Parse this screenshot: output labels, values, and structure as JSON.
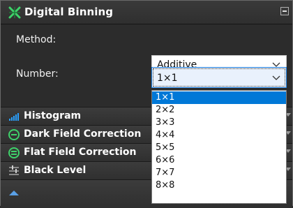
{
  "panel": {
    "title": "Digital Binning",
    "icon": "binning-x-icon"
  },
  "method": {
    "label": "Method:",
    "value": "Additive"
  },
  "number": {
    "label": "Number:",
    "value": "1×1",
    "options": [
      "1×1",
      "2×2",
      "3×3",
      "4×4",
      "5×5",
      "6×6",
      "7×7",
      "8×8"
    ],
    "selected_index": 0
  },
  "sections": [
    {
      "label": "Histogram",
      "icon": "histogram-icon"
    },
    {
      "label": "Dark Field Correction",
      "icon": "dark-field-icon"
    },
    {
      "label": "Flat Field Correction",
      "icon": "flat-field-icon"
    },
    {
      "label": "Black Level",
      "icon": "black-level-icon"
    }
  ],
  "colors": {
    "accent": "#0078d7",
    "panel_bg": "#2c2c2c",
    "header_icon": "#3ed26a"
  }
}
